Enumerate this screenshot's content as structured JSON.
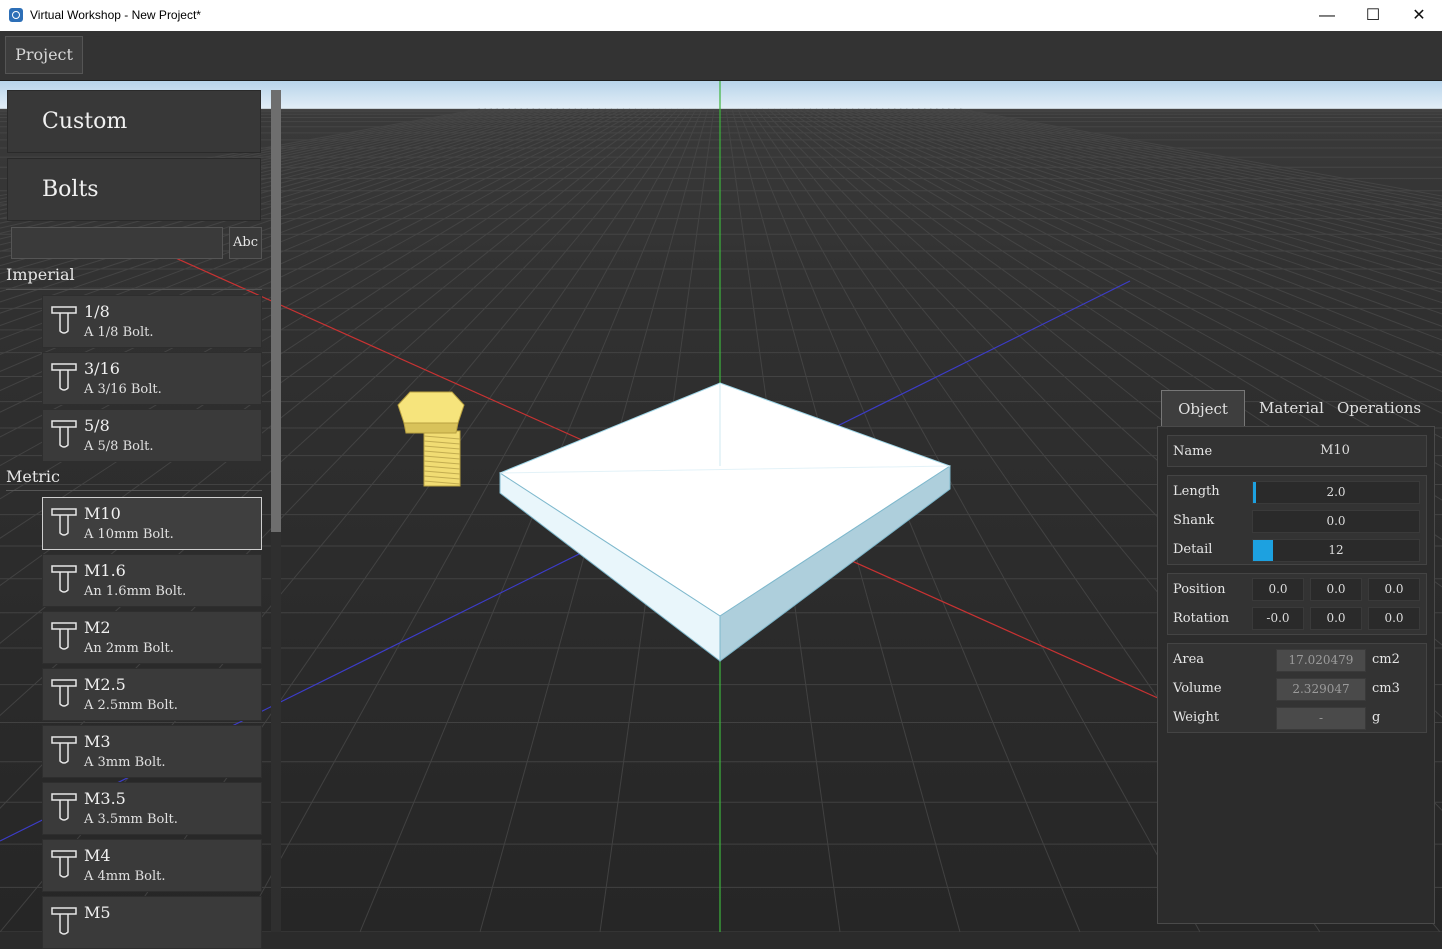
{
  "window": {
    "title": "Virtual Workshop - New Project*",
    "min": "—",
    "max": "☐",
    "close": "✕"
  },
  "menu": {
    "project": "Project"
  },
  "library": {
    "categories": [
      "Custom",
      "Bolts"
    ],
    "search": {
      "value": "",
      "button": "Abc"
    },
    "imperial_label": "Imperial",
    "metric_label": "Metric",
    "imperial": [
      {
        "name": "1/8",
        "desc": "A 1/8 Bolt."
      },
      {
        "name": "3/16",
        "desc": "A 3/16 Bolt."
      },
      {
        "name": "5/8",
        "desc": "A 5/8 Bolt."
      }
    ],
    "metric": [
      {
        "name": "M10",
        "desc": "A 10mm Bolt."
      },
      {
        "name": "M1.6",
        "desc": "An 1.6mm Bolt."
      },
      {
        "name": "M2",
        "desc": "An 2mm Bolt."
      },
      {
        "name": "M2.5",
        "desc": "A 2.5mm Bolt."
      },
      {
        "name": "M3",
        "desc": "A 3mm Bolt."
      },
      {
        "name": "M3.5",
        "desc": "A 3.5mm Bolt."
      },
      {
        "name": "M4",
        "desc": "A 4mm Bolt."
      },
      {
        "name": "M5",
        "desc": ""
      }
    ],
    "selected": "M10"
  },
  "props": {
    "tabs": [
      "Object",
      "Material",
      "Operations"
    ],
    "active_tab": "Object",
    "name_label": "Name",
    "name_value": "M10",
    "length_label": "Length",
    "length_value": "2.0",
    "length_fraction": 0.02,
    "shank_label": "Shank",
    "shank_value": "0.0",
    "detail_label": "Detail",
    "detail_value": "12",
    "detail_fraction": 0.12,
    "position_label": "Position",
    "position": [
      "0.0",
      "0.0",
      "0.0"
    ],
    "rotation_label": "Rotation",
    "rotation": [
      "-0.0",
      "0.0",
      "0.0"
    ],
    "area_label": "Area",
    "area_value": "17.020479",
    "area_unit": "cm2",
    "volume_label": "Volume",
    "volume_value": "2.329047",
    "volume_unit": "cm3",
    "weight_label": "Weight",
    "weight_value": "-",
    "weight_unit": "g"
  },
  "colors": {
    "accent": "#1da1e0",
    "bolt": "#f1dc73",
    "axis_x": "#c83232",
    "axis_y": "#3cb43c",
    "axis_z": "#3c3cc8"
  }
}
